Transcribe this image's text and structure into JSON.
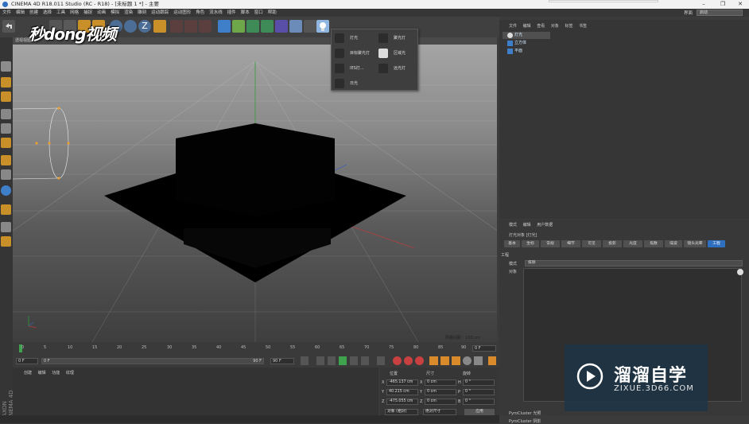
{
  "window": {
    "title": "CINEMA 4D R18.011 Studio (RC - R18) - [未标题 1 *] - 主要",
    "controls": [
      "–",
      "❐",
      "✕"
    ]
  },
  "menu": [
    "文件",
    "编辑",
    "创建",
    "选择",
    "工具",
    "网格",
    "捕捉",
    "动画",
    "模拟",
    "渲染",
    "雕刻",
    "运动跟踪",
    "运动图形",
    "角色",
    "流水线",
    "插件",
    "脚本",
    "窗口",
    "帮助"
  ],
  "layout": {
    "label": "界面",
    "value": "启动"
  },
  "watermark": "秒dong视频",
  "viewport": {
    "header": "透视视图",
    "grid_info": "网格间距：100 cm"
  },
  "light_menu": {
    "items": [
      "灯光",
      "聚光灯",
      "目标聚光灯",
      "区域光",
      "IES灯...",
      "远光灯",
      "日光"
    ]
  },
  "timeline": {
    "ticks": [
      "0",
      "5",
      "10",
      "15",
      "20",
      "25",
      "30",
      "35",
      "40",
      "45",
      "50",
      "55",
      "60",
      "65",
      "70",
      "75",
      "80",
      "85",
      "90"
    ],
    "end_frame": "0 F"
  },
  "transport": {
    "start": "0 F",
    "range_start": "0 F",
    "range_end": "90 F",
    "max": "90 F"
  },
  "material": {
    "menu": [
      "创建",
      "编辑",
      "功能",
      "纹理"
    ]
  },
  "maxon": "MAXON CINEMA 4D",
  "coords": {
    "headers": [
      "位置",
      "尺寸",
      "旋转"
    ],
    "rows": [
      {
        "axis": "X",
        "pos": "-465.137 cm",
        "size_axis": "X",
        "size": "0 cm",
        "rot_axis": "H",
        "rot": "0 °"
      },
      {
        "axis": "Y",
        "pos": "40.215 cm",
        "size_axis": "Y",
        "size": "0 cm",
        "rot_axis": "P",
        "rot": "0 °"
      },
      {
        "axis": "Z",
        "pos": "-475.055 cm",
        "size_axis": "Z",
        "size": "0 cm",
        "rot_axis": "B",
        "rot": "0 °"
      }
    ],
    "mode1": "对象 (相对)",
    "mode2": "绝对尺寸",
    "apply": "应用"
  },
  "object_manager": {
    "menu": [
      "文件",
      "编辑",
      "查看",
      "对象",
      "标签",
      "书签"
    ],
    "objects": [
      "灯光",
      "立方体",
      "平面"
    ]
  },
  "attribute_manager": {
    "menu": [
      "模式",
      "编辑",
      "用户数据"
    ],
    "title": "灯光对象 [灯光]",
    "tabs": [
      "基本",
      "坐标",
      "常规",
      "细节",
      "可见",
      "投影",
      "光度",
      "焦散",
      "噪波",
      "镜头光晕",
      "工程"
    ],
    "active_tab": "工程",
    "section": "工程",
    "mode_label": "模式",
    "mode_value": "排除",
    "objects_label": "对象"
  },
  "pyro": [
    "PyroCluster 光照",
    "PyroCluster 阴影"
  ],
  "brand": {
    "title": "溜溜自学",
    "subtitle": "ZIXUE.3D66.COM"
  },
  "colors": {
    "accent": "#2f6fbf",
    "bg": "#3b3b3b"
  }
}
